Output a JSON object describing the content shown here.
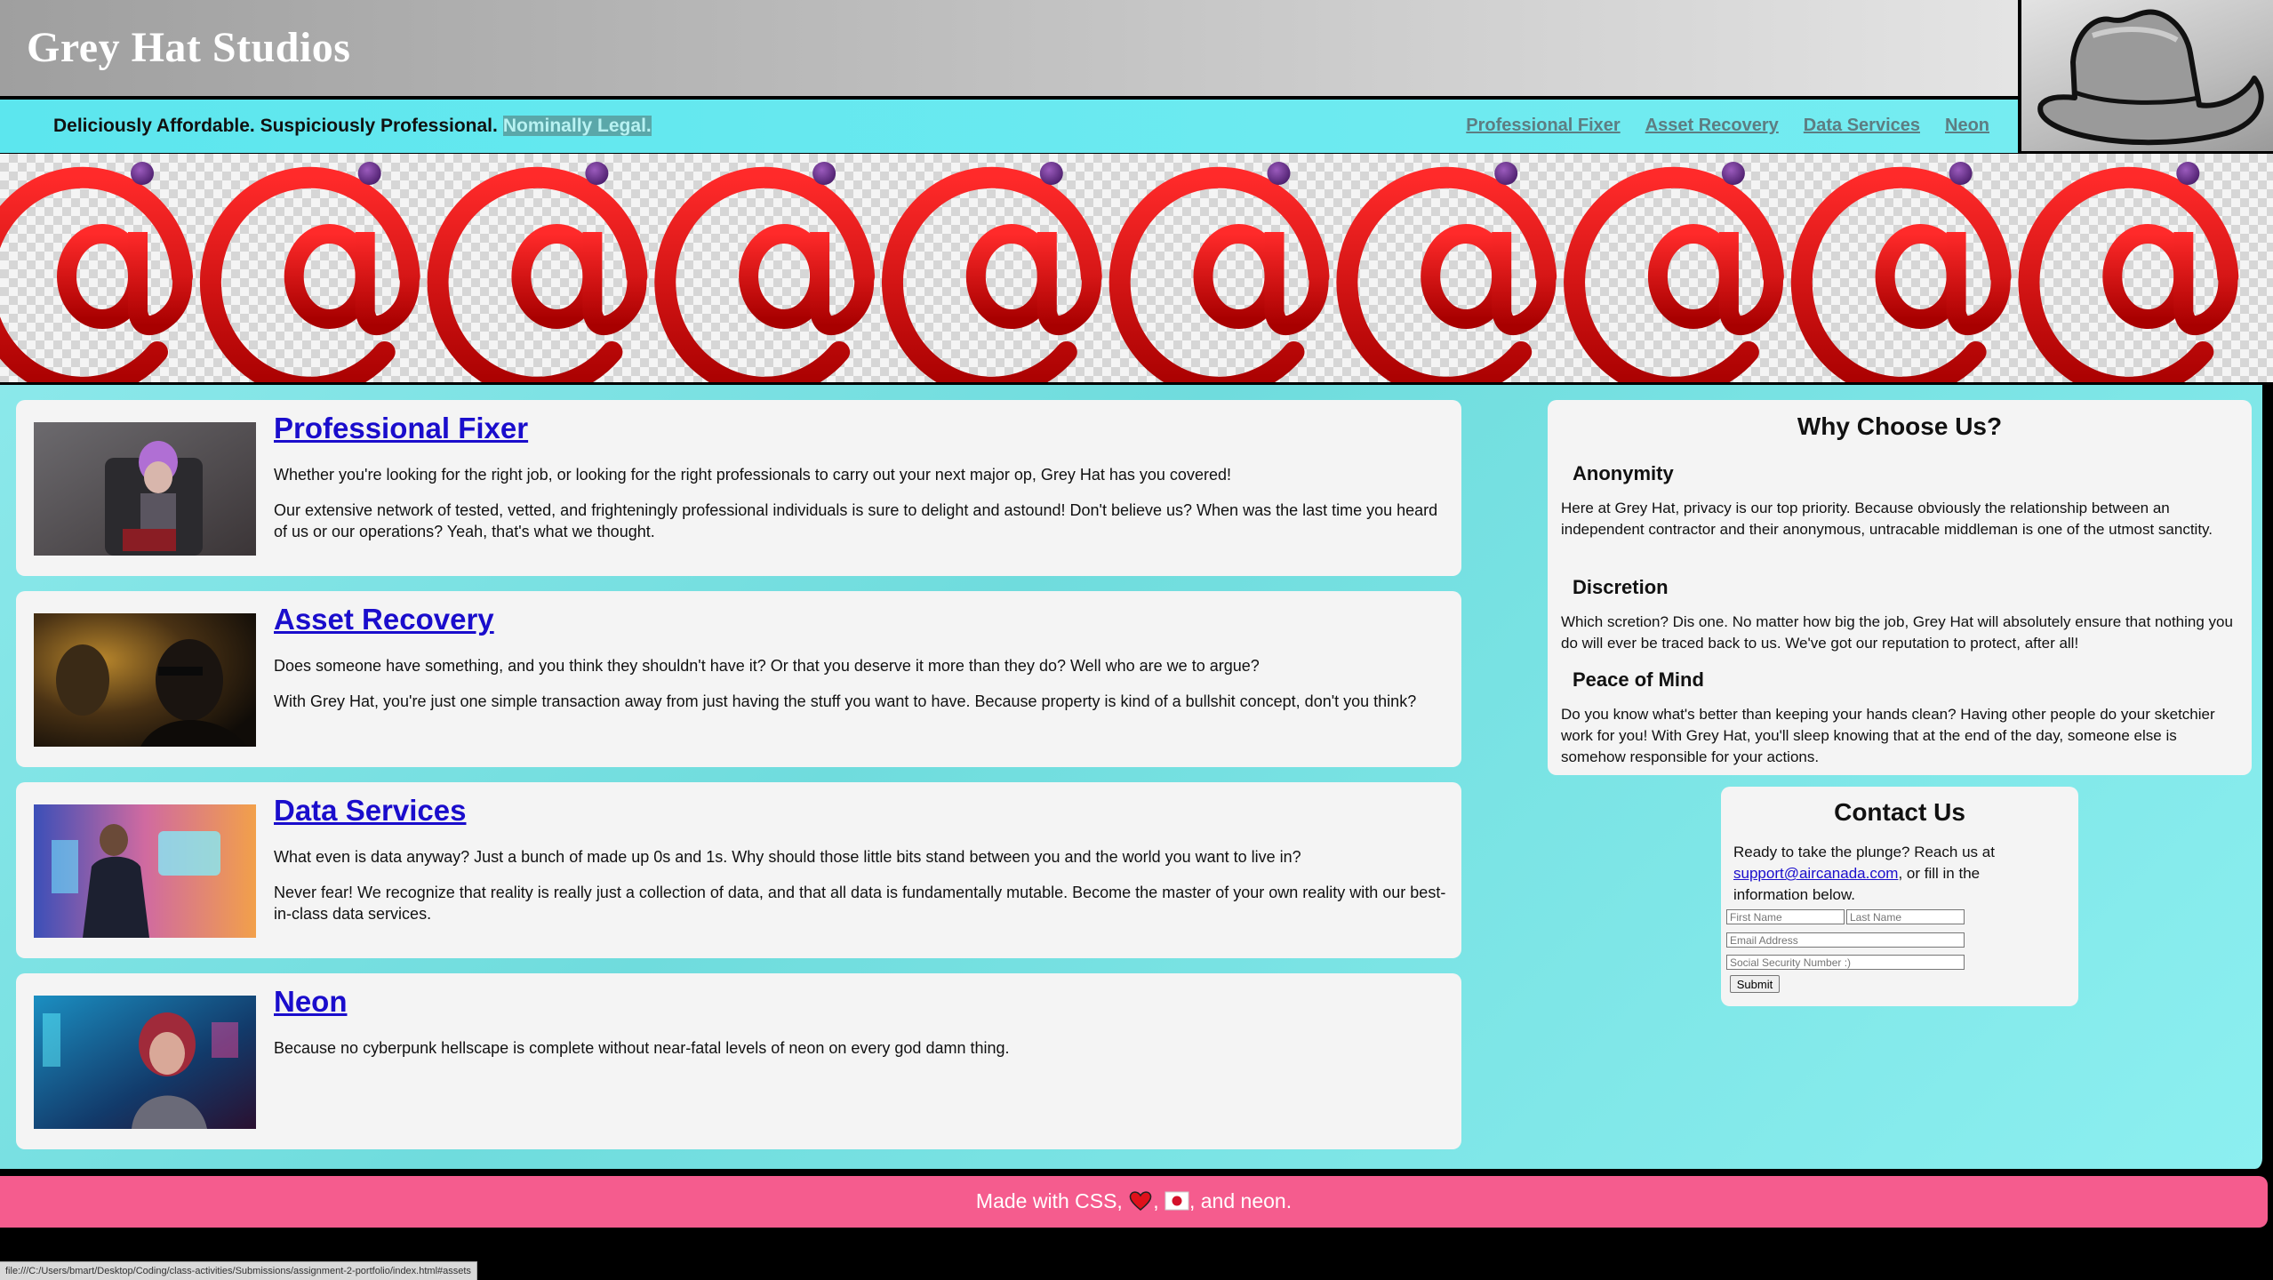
{
  "header": {
    "title": "Grey Hat Studios",
    "tagline": "Deliciously Affordable. Suspiciously Professional.",
    "tagline_highlight": "Nominally Legal.",
    "logo_icon": "grey-fedora-hat-icon"
  },
  "nav": {
    "items": [
      {
        "label": "Professional Fixer"
      },
      {
        "label": "Asset Recovery"
      },
      {
        "label": "Data Services"
      },
      {
        "label": "Neon"
      }
    ]
  },
  "banner": {
    "icon": "red-at-sign-icon",
    "repeat_count": 10
  },
  "services": [
    {
      "title": "Professional Fixer",
      "paragraphs": [
        "Whether you're looking for the right job, or looking for the right professionals to carry out your next major op, Grey Hat has you covered!",
        "Our extensive network of tested, vetted, and frighteningly professional individuals is sure to delight and astound! Don't believe us? When was the last time you heard of us or our operations? Yeah, that's what we thought."
      ]
    },
    {
      "title": "Asset Recovery",
      "paragraphs": [
        "Does someone have something, and you think they shouldn't have it? Or that you deserve it more than they do? Well who are we to argue?",
        "With Grey Hat, you're just one simple transaction away from just having the stuff you want to have. Because property is kind of a bullshit concept, don't you think?"
      ]
    },
    {
      "title": "Data Services",
      "paragraphs": [
        "What even is data anyway? Just a bunch of made up 0s and 1s. Why should those little bits stand between you and the world you want to live in?",
        "Never fear! We recognize that reality is really just a collection of data, and that all data is fundamentally mutable. Become the master of your own reality with our best-in-class data services."
      ]
    },
    {
      "title": "Neon",
      "paragraphs": [
        "Because no cyberpunk hellscape is complete without near-fatal levels of neon on every god damn thing."
      ]
    }
  ],
  "why": {
    "title": "Why Choose Us?",
    "items": [
      {
        "title": "Anonymity",
        "text": "Here at Grey Hat, privacy is our top priority. Because obviously the relationship between an independent contractor and their anonymous, untracable middleman is one of the utmost sanctity."
      },
      {
        "title": "Discretion",
        "text": "Which scretion? Dis one. No matter how big the job, Grey Hat will absolutely ensure that nothing you do will ever be traced back to us. We've got our reputation to protect, after all!"
      },
      {
        "title": "Peace of Mind",
        "text": "Do you know what's better than keeping your hands clean? Having other people do your sketchier work for you! With Grey Hat, you'll sleep knowing that at the end of the day, someone else is somehow responsible for your actions."
      }
    ]
  },
  "contact": {
    "title": "Contact Us",
    "text_before": "Ready to take the plunge? Reach us at",
    "email": "support@aircanada.com",
    "text_after": ", or fill in the information below.",
    "first_name_placeholder": "First Name",
    "last_name_placeholder": "Last Name",
    "email_placeholder": "Email Address",
    "ssn_placeholder": "Social Security Number :)",
    "submit_label": "Submit"
  },
  "footer": {
    "text_before": "Made with CSS,",
    "sep": ",",
    "text_after": ", and neon.",
    "heart_icon": "red-heart-icon",
    "flag_icon": "japan-flag-icon"
  },
  "status_bar": {
    "url": "file:///C:/Users/bmart/Desktop/Coding/class-activities/Submissions/assignment-2-portfolio/index.html#assets"
  }
}
